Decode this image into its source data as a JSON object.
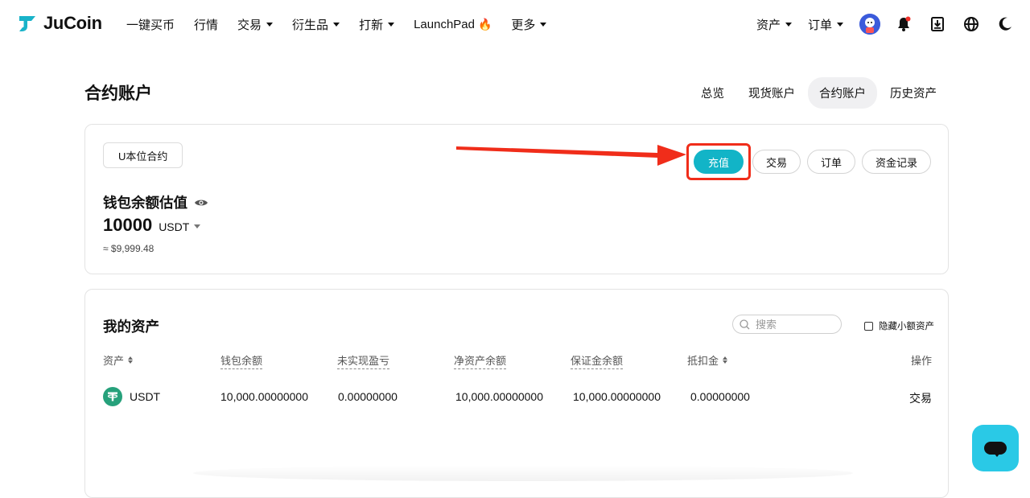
{
  "header": {
    "brand": "JuCoin",
    "nav": [
      {
        "label": "一键买币",
        "caret": false
      },
      {
        "label": "行情",
        "caret": false
      },
      {
        "label": "交易",
        "caret": true
      },
      {
        "label": "衍生品",
        "caret": true
      },
      {
        "label": "打新",
        "caret": true
      },
      {
        "label": "LaunchPad",
        "caret": false,
        "flame": "🔥"
      },
      {
        "label": "更多",
        "caret": true
      }
    ],
    "right": {
      "assets": "资产",
      "orders": "订单"
    }
  },
  "page": {
    "title": "合约账户",
    "tabs": [
      "总览",
      "现货账户",
      "合约账户",
      "历史资产"
    ],
    "active_tab": "合约账户"
  },
  "account_card": {
    "contract_type": "U本位合约",
    "buttons": {
      "deposit": "充值",
      "trade": "交易",
      "orders": "订单",
      "records": "资金记录"
    },
    "balance_label": "钱包余额估值",
    "balance_value": "10000",
    "balance_unit": "USDT",
    "balance_usd": "≈ $9,999.48"
  },
  "assets": {
    "title": "我的资产",
    "search_placeholder": "搜索",
    "hide_small": "隐藏小额资产",
    "columns": {
      "asset": "资产",
      "wallet": "钱包余额",
      "unrealized": "未实现盈亏",
      "net": "净资产余额",
      "margin": "保证金余额",
      "deduction": "抵扣金",
      "action": "操作"
    },
    "rows": [
      {
        "coin": "USDT",
        "wallet": "10,000.00000000",
        "unrealized": "0.00000000",
        "net": "10,000.00000000",
        "margin": "10,000.00000000",
        "deduction": "0.00000000",
        "action": "交易"
      }
    ]
  },
  "colors": {
    "accent": "#12b4c7",
    "highlight": "#f02d1a",
    "chat": "#2ac9e6",
    "usdt": "#26a17b"
  }
}
